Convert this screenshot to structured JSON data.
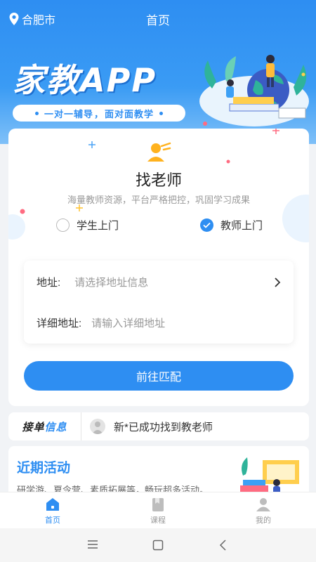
{
  "header": {
    "location": "合肥市",
    "title": "首页"
  },
  "banner": {
    "brand": "家教APP",
    "slogan_left": "一对一辅导",
    "slogan_right": "面对面教学"
  },
  "card": {
    "title": "找老师",
    "subtitle": "海量教师资源，平台严格把控，巩固学习成果",
    "options": [
      {
        "label": "学生上门",
        "selected": false
      },
      {
        "label": "教师上门",
        "selected": true
      }
    ],
    "address_label": "地址:",
    "address_placeholder": "请选择地址信息",
    "detail_label": "详细地址:",
    "detail_placeholder": "请输入详细地址",
    "submit_label": "前往匹配"
  },
  "ticker": {
    "tag_a": "接单",
    "tag_b": "信息",
    "message": "新*已成功找到教老师"
  },
  "activity": {
    "title": "近期活动",
    "desc": "研学游、夏令营、素质拓展等，畅玩超多活动。"
  },
  "tabs": [
    {
      "label": "首页",
      "icon": "home-icon",
      "active": true
    },
    {
      "label": "课程",
      "icon": "book-icon",
      "active": false
    },
    {
      "label": "我的",
      "icon": "user-icon",
      "active": false
    }
  ],
  "colors": {
    "primary": "#2e8ef2",
    "text": "#333333",
    "muted": "#999999"
  }
}
